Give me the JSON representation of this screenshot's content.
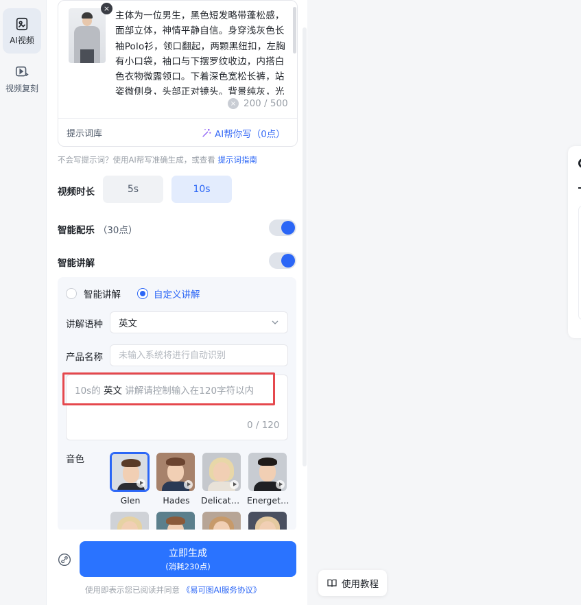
{
  "rail": {
    "items": [
      {
        "label": "AI视频",
        "icon": "ai-video-icon",
        "active": true
      },
      {
        "label": "视频复刻",
        "icon": "video-replicate-icon",
        "active": false
      }
    ]
  },
  "prompt": {
    "text": "主体为一位男生，黑色短发略带蓬松感，面部立体，神情平静自信。身穿浅灰色长袖Polo衫，领口翻起，两颗黑纽扣，左胸有小口袋，袖口与下摆罗纹收边，内搭白色衣物微露领口。下着深色宽松长裤，站姿微侧身，头部正对镜头。背景纯灰，光",
    "counter": "200 / 500",
    "library_label": "提示词库",
    "ai_write_label": "AI帮你写（0点）"
  },
  "hint": {
    "text": "不会写提示词？使用AI帮写准确生成，或查看",
    "link": "提示词指南"
  },
  "duration": {
    "label": "视频时长",
    "options": [
      "5s",
      "10s"
    ],
    "selected": "10s"
  },
  "music": {
    "label": "智能配乐",
    "cost": "（30点）",
    "enabled": true
  },
  "narration": {
    "label": "智能讲解",
    "enabled": true,
    "mode_smart": "智能讲解",
    "mode_custom": "自定义讲解",
    "selected_mode": "自定义讲解",
    "language_label": "讲解语种",
    "language_value": "英文",
    "product_label": "产品名称",
    "product_placeholder": "未输入系统将进行自动识别",
    "placeholder_prefix": "10s的",
    "placeholder_lang": "英文",
    "placeholder_suffix": "讲解请控制输入在120字符以内",
    "count": "0 / 120"
  },
  "voices": {
    "label": "音色",
    "items": [
      "Glen",
      "Hades",
      "Delicate...",
      "Energeti..."
    ],
    "selected": "Glen"
  },
  "generate": {
    "label": "立即生成",
    "cost": "(消耗230点)"
  },
  "agreement": {
    "text": "使用即表示您已阅读并同意",
    "link": "《易可图AI服务协议》"
  },
  "tutorial": {
    "label": "使用教程"
  },
  "colors": {
    "accent": "#2b66f6",
    "button": "#2a73ff",
    "highlight": "#e5484d"
  }
}
